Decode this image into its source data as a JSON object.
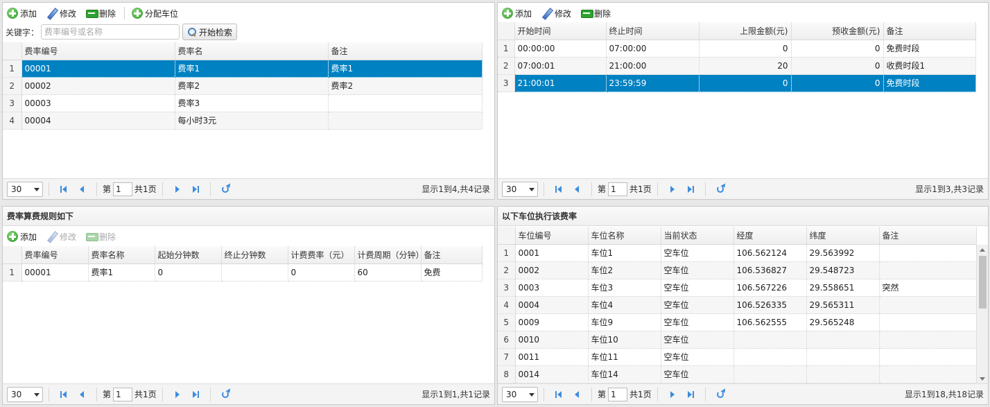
{
  "p1": {
    "toolbar": {
      "add": "添加",
      "edit": "修改",
      "delete": "删除",
      "assign": "分配车位"
    },
    "search": {
      "label": "关键字：",
      "placeholder": "费率编号或名称",
      "button": "开始检索"
    },
    "columns": [
      "费率编号",
      "费率名",
      "备注"
    ],
    "rows": [
      {
        "n": "1",
        "c": [
          "00001",
          "费率1",
          "费率1"
        ]
      },
      {
        "n": "2",
        "c": [
          "00002",
          "费率2",
          "费率2"
        ]
      },
      {
        "n": "3",
        "c": [
          "00003",
          "费率3",
          ""
        ]
      },
      {
        "n": "4",
        "c": [
          "00004",
          "每小时3元",
          ""
        ]
      }
    ],
    "pager": {
      "size": "30",
      "page_prefix": "第",
      "page": "1",
      "page_total": "共1页",
      "info": "显示1到4,共4记录"
    }
  },
  "p2": {
    "toolbar": {
      "add": "添加",
      "edit": "修改",
      "delete": "删除"
    },
    "columns": [
      "开始时间",
      "终止时间",
      "上限金额(元)",
      "预收金额(元)",
      "备注"
    ],
    "rows": [
      {
        "n": "1",
        "c": [
          "00:00:00",
          "07:00:00",
          "0",
          "0",
          "免费时段"
        ]
      },
      {
        "n": "2",
        "c": [
          "07:00:01",
          "21:00:00",
          "20",
          "0",
          "收费时段1"
        ]
      },
      {
        "n": "3",
        "c": [
          "21:00:01",
          "23:59:59",
          "0",
          "0",
          "免费时段"
        ]
      }
    ],
    "pager": {
      "size": "30",
      "page_prefix": "第",
      "page": "1",
      "page_total": "共1页",
      "info": "显示1到3,共3记录"
    }
  },
  "p3": {
    "title": "费率算费规则如下",
    "toolbar": {
      "add": "添加",
      "edit": "修改",
      "delete": "删除"
    },
    "columns": [
      "费率编号",
      "费率名称",
      "起始分钟数",
      "终止分钟数",
      "计费费率（元）",
      "计费周期（分钟）",
      "备注"
    ],
    "rows": [
      {
        "n": "1",
        "c": [
          "00001",
          "费率1",
          "0",
          "",
          "0",
          "60",
          "免费"
        ]
      }
    ],
    "pager": {
      "size": "30",
      "page_prefix": "第",
      "page": "1",
      "page_total": "共1页",
      "info": "显示1到1,共1记录"
    }
  },
  "p4": {
    "title": "以下车位执行该费率",
    "columns": [
      "车位编号",
      "车位名称",
      "当前状态",
      "经度",
      "纬度",
      "备注"
    ],
    "rows": [
      {
        "n": "1",
        "c": [
          "0001",
          "车位1",
          "空车位",
          "106.562124",
          "29.563992",
          ""
        ]
      },
      {
        "n": "2",
        "c": [
          "0002",
          "车位2",
          "空车位",
          "106.536827",
          "29.548723",
          ""
        ]
      },
      {
        "n": "3",
        "c": [
          "0003",
          "车位3",
          "空车位",
          "106.567226",
          "29.558651",
          "突然"
        ]
      },
      {
        "n": "4",
        "c": [
          "0004",
          "车位4",
          "空车位",
          "106.526335",
          "29.565311",
          ""
        ]
      },
      {
        "n": "5",
        "c": [
          "0009",
          "车位9",
          "空车位",
          "106.562555",
          "29.565248",
          ""
        ]
      },
      {
        "n": "6",
        "c": [
          "0010",
          "车位10",
          "空车位",
          "",
          "",
          ""
        ]
      },
      {
        "n": "7",
        "c": [
          "0011",
          "车位11",
          "空车位",
          "",
          "",
          ""
        ]
      },
      {
        "n": "8",
        "c": [
          "0014",
          "车位14",
          "空车位",
          "",
          "",
          ""
        ]
      }
    ],
    "pager": {
      "size": "30",
      "page_prefix": "第",
      "page": "1",
      "page_total": "共1页",
      "info": "显示1到18,共18记录"
    }
  },
  "colors": {
    "selected_row": "#0081c2",
    "add_icon": "#2f9a2a",
    "pager_icon": "#3c8dde"
  },
  "icons": {
    "add": "plus-circle-icon",
    "edit": "pencil-icon",
    "delete": "minus-rect-icon",
    "search": "magnifier-icon"
  }
}
